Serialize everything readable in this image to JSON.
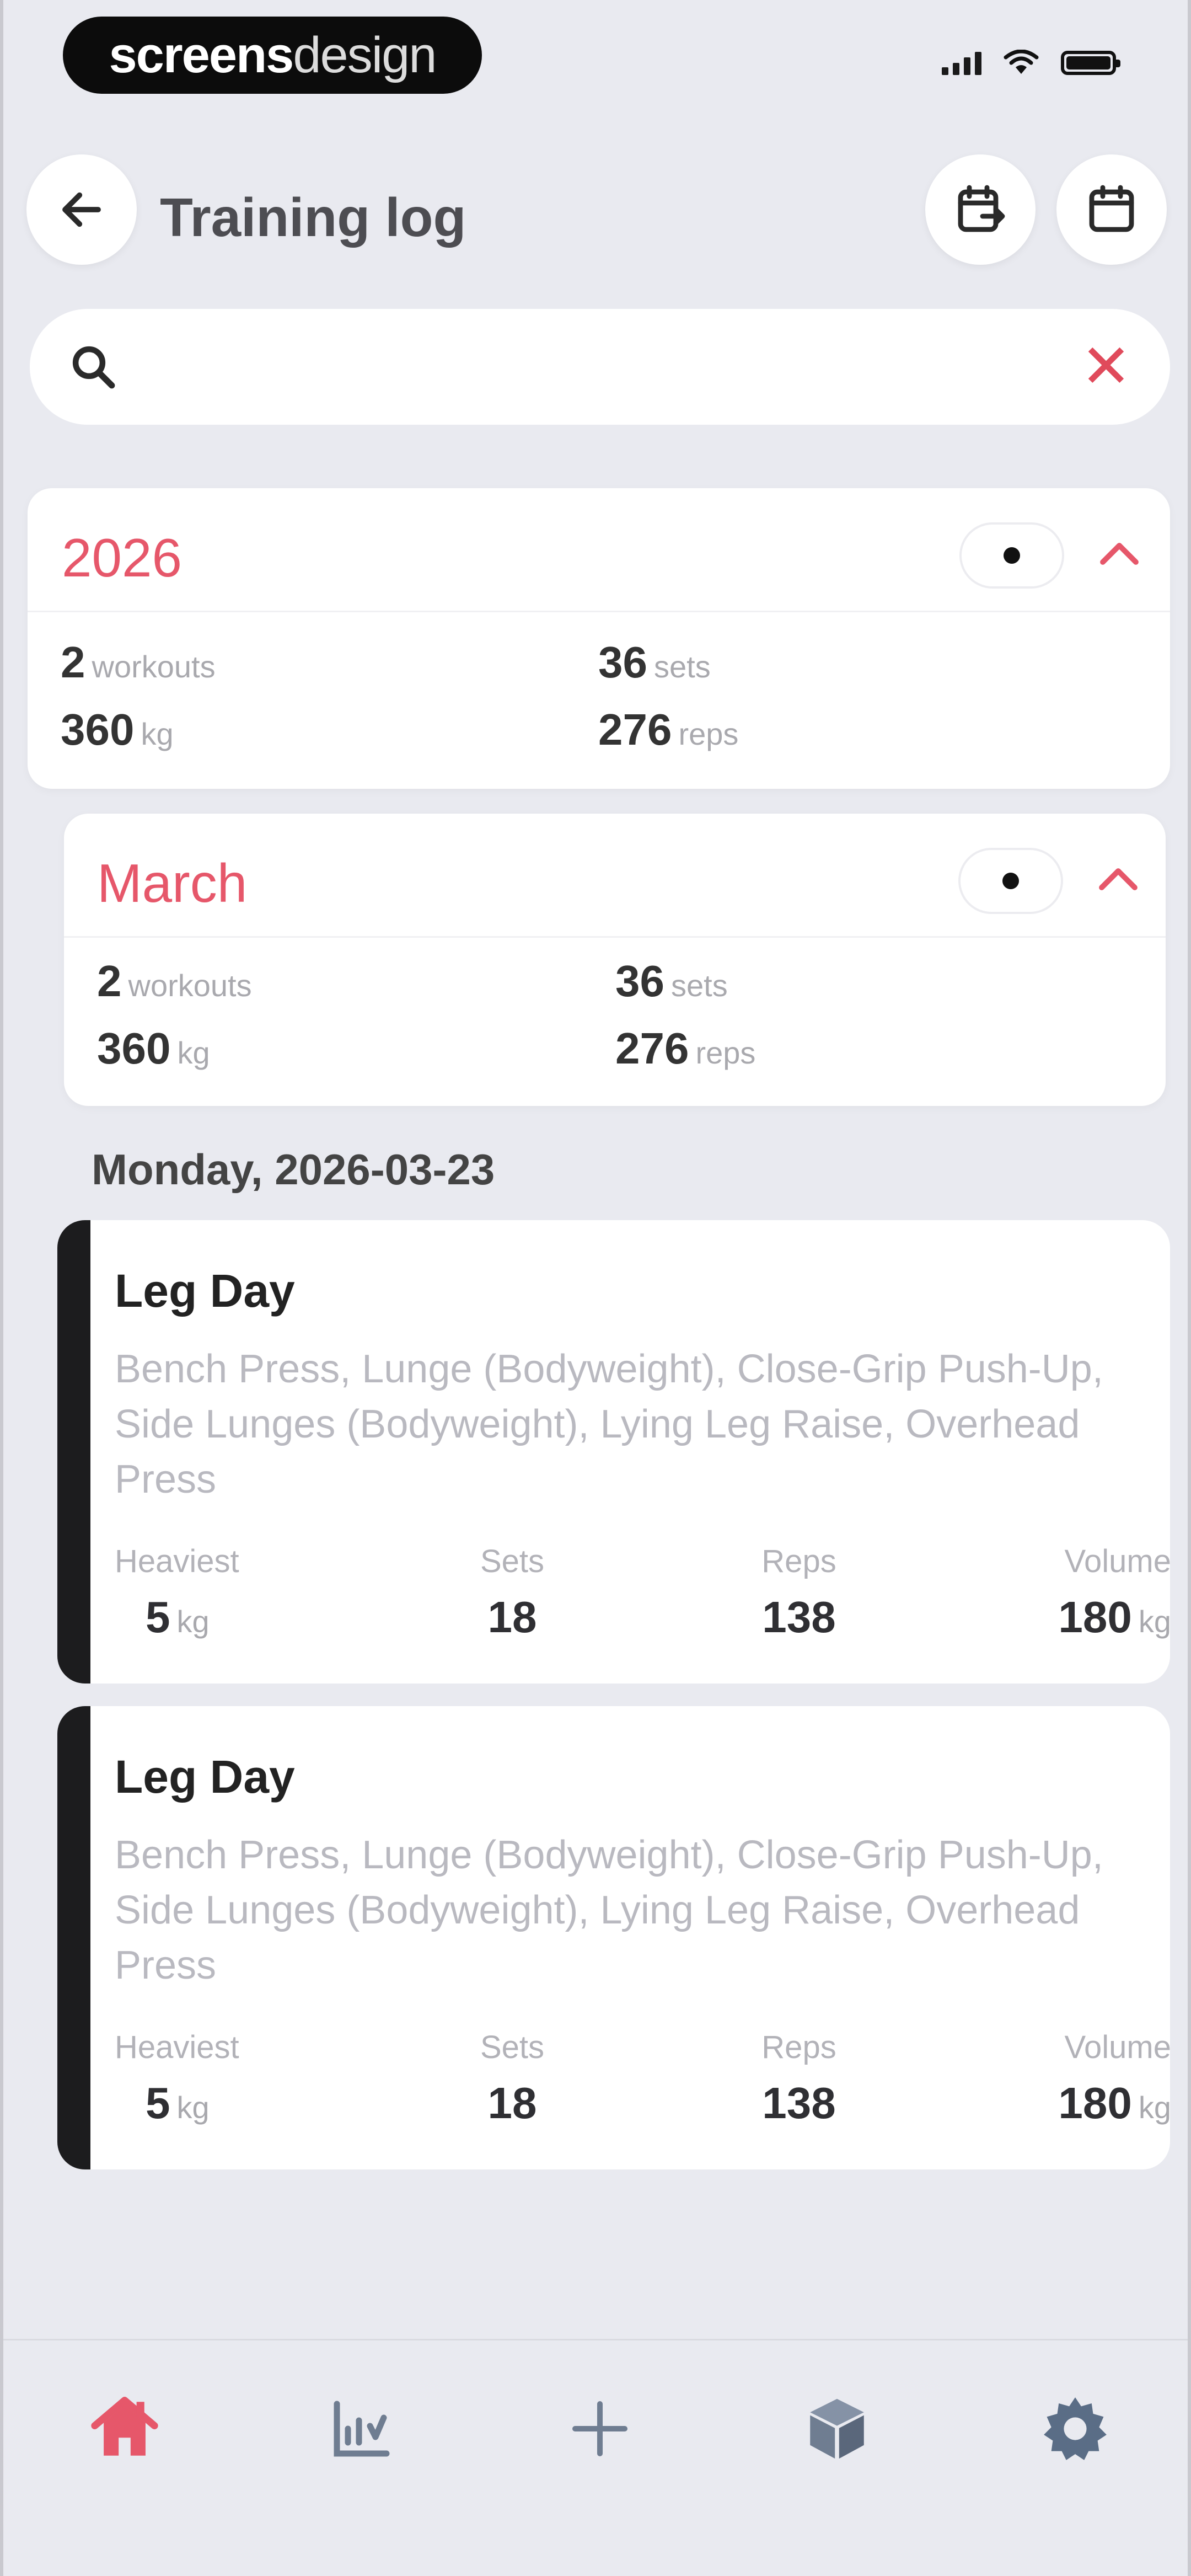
{
  "status_bar": {
    "brand_bold": "screens",
    "brand_light": "design"
  },
  "header": {
    "title": "Training log",
    "back_icon": "arrow-left-icon",
    "calendar_swap_icon": "calendar-swap-icon",
    "calendar_icon": "calendar-icon"
  },
  "search": {
    "value": "",
    "placeholder": "",
    "clear_label": "✕"
  },
  "year_summary": {
    "title": "2026",
    "workouts_value": "2",
    "workouts_unit": "workouts",
    "sets_value": "36",
    "sets_unit": "sets",
    "weight_value": "360",
    "weight_unit": "kg",
    "reps_value": "276",
    "reps_unit": "reps"
  },
  "month_summary": {
    "title": "March",
    "workouts_value": "2",
    "workouts_unit": "workouts",
    "sets_value": "36",
    "sets_unit": "sets",
    "weight_value": "360",
    "weight_unit": "kg",
    "reps_value": "276",
    "reps_unit": "reps"
  },
  "day_header": "Monday, 2026-03-23",
  "workouts": [
    {
      "name": "Leg Day",
      "exercises": "Bench Press, Lunge (Bodyweight), Close-Grip Push-Up, Side Lunges (Bodyweight), Lying Leg Raise, Overhead Press",
      "heaviest_label": "Heaviest",
      "heaviest_value": "5",
      "heaviest_unit": "kg",
      "sets_label": "Sets",
      "sets_value": "18",
      "reps_label": "Reps",
      "reps_value": "138",
      "volume_label": "Volume",
      "volume_value": "180",
      "volume_unit": "kg"
    },
    {
      "name": "Leg Day",
      "exercises": "Bench Press, Lunge (Bodyweight), Close-Grip Push-Up, Side Lunges (Bodyweight), Lying Leg Raise, Overhead Press",
      "heaviest_label": "Heaviest",
      "heaviest_value": "5",
      "heaviest_unit": "kg",
      "sets_label": "Sets",
      "sets_value": "18",
      "reps_label": "Reps",
      "reps_value": "138",
      "volume_label": "Volume",
      "volume_value": "180",
      "volume_unit": "kg"
    }
  ],
  "bottom_nav": {
    "items": [
      "home-icon",
      "chart-icon",
      "plus-icon",
      "box-icon",
      "gear-icon"
    ],
    "active": "home-icon"
  },
  "colors": {
    "accent": "#e6576a",
    "card_stripe": "#1c1c1e",
    "background": "#e9eaf0"
  }
}
